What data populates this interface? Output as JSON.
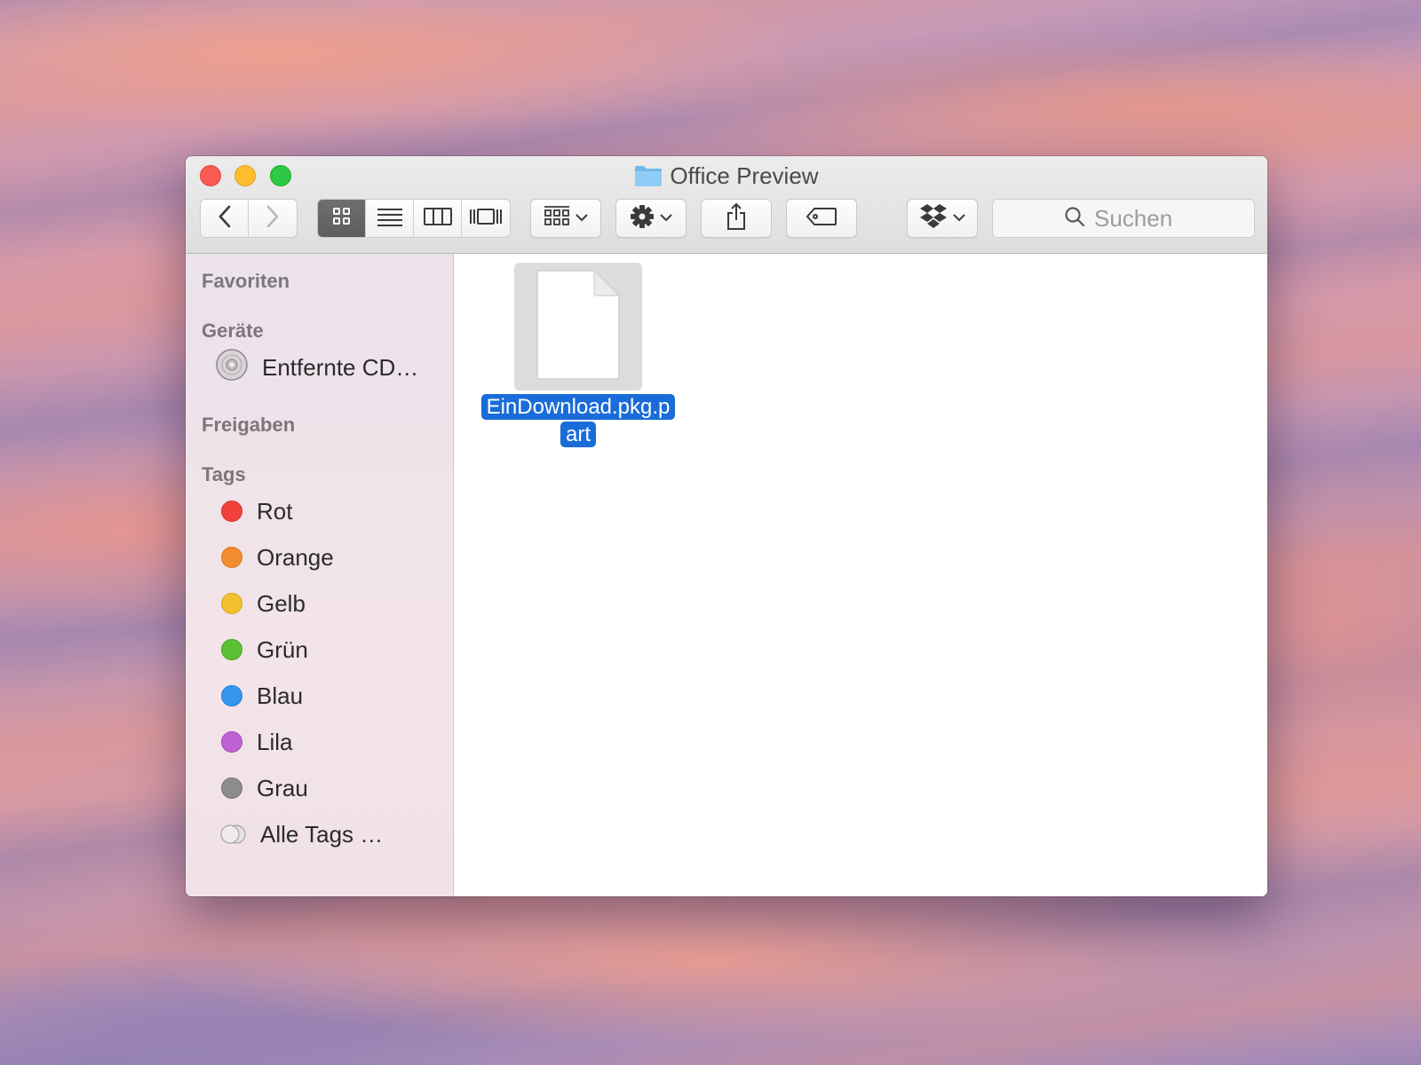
{
  "window": {
    "title": "Office Preview"
  },
  "toolbar": {
    "back_icon": "chevron-left-icon",
    "forward_icon": "chevron-right-icon",
    "view_modes": [
      "icon-view",
      "list-view",
      "column-view",
      "coverflow-view"
    ],
    "arrange_icon": "arrange-grid-icon",
    "action_icon": "gear-icon",
    "share_icon": "share-icon",
    "tag_icon": "tag-icon",
    "dropbox_icon": "dropbox-icon",
    "search": {
      "placeholder": "Suchen",
      "value": ""
    }
  },
  "sidebar": {
    "sections": {
      "favorites": "Favoriten",
      "devices": "Geräte",
      "shared": "Freigaben",
      "tags": "Tags"
    },
    "devices": [
      {
        "label": "Entfernte CD…",
        "icon": "cd-disc-icon"
      }
    ],
    "tags": [
      {
        "label": "Rot",
        "color": "#f2413b"
      },
      {
        "label": "Orange",
        "color": "#f48d30"
      },
      {
        "label": "Gelb",
        "color": "#f3c02f"
      },
      {
        "label": "Grün",
        "color": "#5cc035"
      },
      {
        "label": "Blau",
        "color": "#3596ef"
      },
      {
        "label": "Lila",
        "color": "#c062d4"
      },
      {
        "label": "Grau",
        "color": "#8e8b8e"
      },
      {
        "label": "Alle Tags …",
        "color": ""
      }
    ]
  },
  "files": [
    {
      "name_line1": "EinDownload.pkg.p",
      "name_line2": "art",
      "selected": true,
      "icon": "document-icon"
    }
  ]
}
